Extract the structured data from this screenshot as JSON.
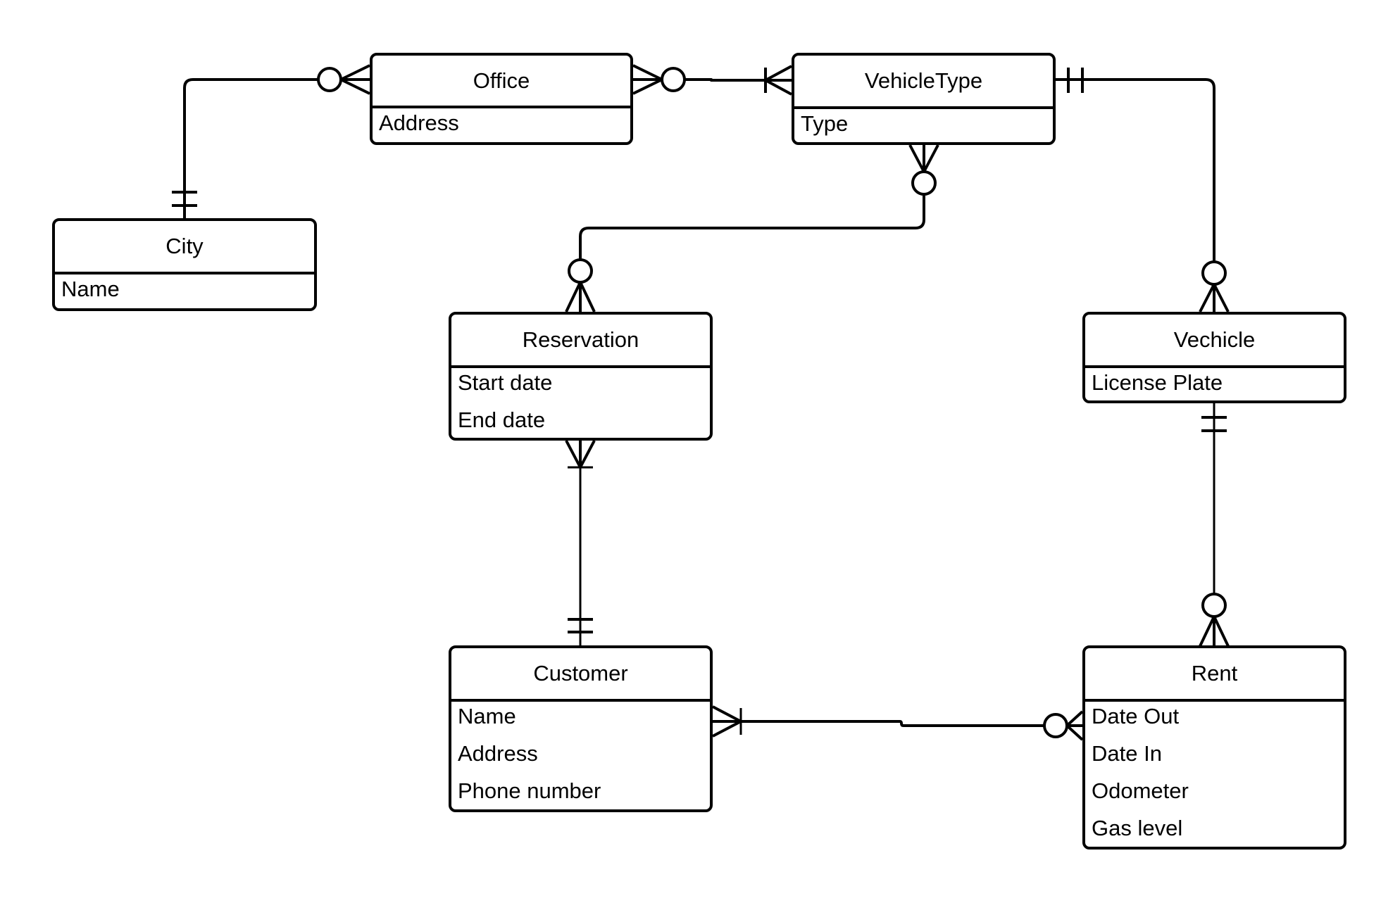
{
  "diagram": {
    "type": "entity-relationship",
    "notation": "crow's foot",
    "entities": [
      {
        "id": "office",
        "name": "Office",
        "attributes": [
          "Address"
        ]
      },
      {
        "id": "vehicletype",
        "name": "VehicleType",
        "attributes": [
          "Type"
        ]
      },
      {
        "id": "city",
        "name": "City",
        "attributes": [
          "Name"
        ]
      },
      {
        "id": "reservation",
        "name": "Reservation",
        "attributes": [
          "Start date",
          "End date"
        ]
      },
      {
        "id": "vechicle",
        "name": "Vechicle",
        "attributes": [
          "License Plate"
        ]
      },
      {
        "id": "customer",
        "name": "Customer",
        "attributes": [
          "Name",
          "Address",
          "Phone number"
        ]
      },
      {
        "id": "rent",
        "name": "Rent",
        "attributes": [
          "Date Out",
          "Date In",
          "Odometer",
          "Gas level"
        ]
      }
    ],
    "relationships": [
      {
        "from": "City",
        "to": "Office",
        "from_cardinality": "one-and-only-one",
        "to_cardinality": "zero-or-many"
      },
      {
        "from": "Office",
        "to": "VehicleType",
        "from_cardinality": "zero-or-many",
        "to_cardinality": "one-or-many"
      },
      {
        "from": "VehicleType",
        "to": "Vechicle",
        "from_cardinality": "one-and-only-one",
        "to_cardinality": "zero-or-many"
      },
      {
        "from": "VehicleType",
        "to": "Reservation",
        "from_cardinality": "zero-or-many",
        "to_cardinality": "zero-or-many"
      },
      {
        "from": "Reservation",
        "to": "Customer",
        "from_cardinality": "one-or-many",
        "to_cardinality": "one-and-only-one"
      },
      {
        "from": "Vechicle",
        "to": "Rent",
        "from_cardinality": "one-and-only-one",
        "to_cardinality": "zero-or-many"
      },
      {
        "from": "Customer",
        "to": "Rent",
        "from_cardinality": "one-or-many",
        "to_cardinality": "zero-or-many"
      }
    ]
  }
}
